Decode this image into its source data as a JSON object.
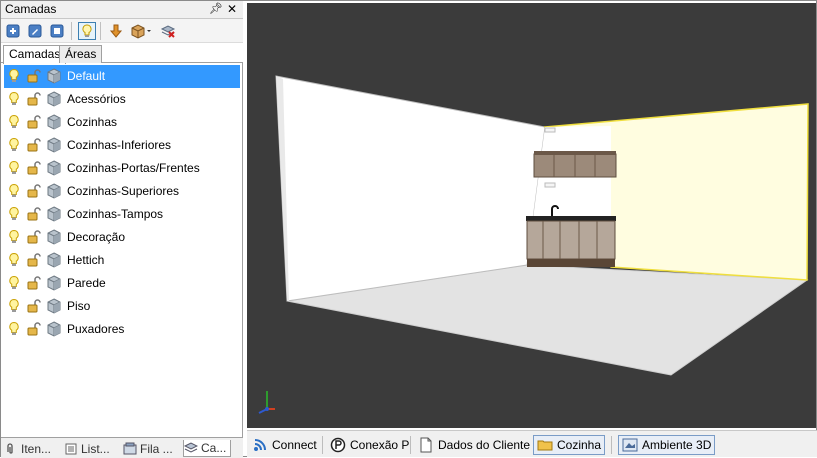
{
  "panel": {
    "title": "Camadas",
    "pin_icon": "pin-icon",
    "close_icon": "close-icon"
  },
  "toolbar": [
    {
      "name": "add-layer-button",
      "icon": "add-layer-icon"
    },
    {
      "name": "edit-layer-button",
      "icon": "edit-layer-icon"
    },
    {
      "name": "layer-props-button",
      "icon": "layer-properties-icon"
    },
    {
      "name": "visibility-toggle-button",
      "icon": "lightbulb-icon",
      "active": true
    },
    {
      "name": "move-down-button",
      "icon": "arrow-down-icon"
    },
    {
      "name": "box-menu-button",
      "icon": "box-dropdown-icon"
    },
    {
      "name": "delete-layers-button",
      "icon": "delete-layers-icon"
    }
  ],
  "tabs": [
    {
      "label": "Camadas",
      "selected": true
    },
    {
      "label": "Áreas",
      "selected": false
    }
  ],
  "layers": [
    {
      "label": "Default",
      "selected": true
    },
    {
      "label": "Acessórios"
    },
    {
      "label": "Cozinhas"
    },
    {
      "label": "Cozinhas-Inferiores"
    },
    {
      "label": "Cozinhas-Portas/Frentes"
    },
    {
      "label": "Cozinhas-Superiores"
    },
    {
      "label": "Cozinhas-Tampos"
    },
    {
      "label": "Decoração"
    },
    {
      "label": "Hettich"
    },
    {
      "label": "Parede"
    },
    {
      "label": "Piso"
    },
    {
      "label": "Puxadores"
    }
  ],
  "bottom_tabs": [
    {
      "label": "Iten..."
    },
    {
      "label": "List..."
    },
    {
      "label": "Fila ..."
    },
    {
      "label": "Ca..."
    }
  ],
  "statusbar": [
    {
      "label": "Connect",
      "icon": "rss-icon"
    },
    {
      "label": "Conexão P",
      "icon": "promob-icon"
    },
    {
      "label": "Dados do Cliente",
      "icon": "document-icon"
    },
    {
      "label": "Cozinha",
      "icon": "folder-icon",
      "boxed": true
    },
    {
      "label": "Ambiente 3D",
      "icon": "environment-3d-icon",
      "boxed": true
    }
  ],
  "colors": {
    "selection": "#3399ff",
    "viewport_bg": "#3b3b3b",
    "highlight_wall": "#fffde0",
    "highlight_edge": "#f3e24a"
  }
}
